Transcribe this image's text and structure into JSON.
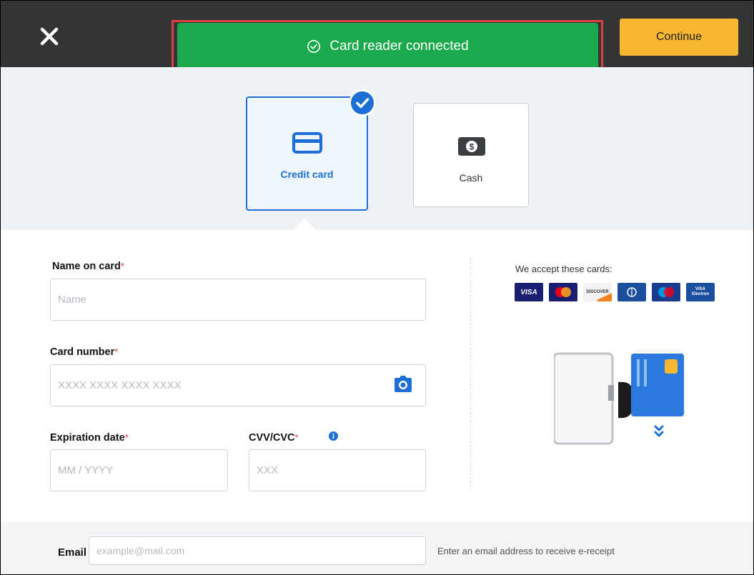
{
  "header": {
    "close_icon": "close-icon",
    "continue_label": "Continue",
    "toast_text": "Card reader connected",
    "toast_icon": "check-circle-icon",
    "toast_color": "#1aa94c",
    "accent_color": "#1d6fd6",
    "continue_color": "#f7b731"
  },
  "payment_methods": [
    {
      "label": "Credit card",
      "icon": "credit-card-icon",
      "selected": true
    },
    {
      "label": "Cash",
      "icon": "cash-icon",
      "selected": false
    }
  ],
  "form": {
    "name": {
      "label": "Name on card",
      "required_mark": "*",
      "placeholder": "Name",
      "value": ""
    },
    "card_number": {
      "label": "Card number",
      "required_mark": "*",
      "placeholder": "XXXX XXXX XXXX XXXX",
      "value": "",
      "scan_icon": "camera-icon"
    },
    "expiration": {
      "label": "Expiration date",
      "required_mark": "*",
      "placeholder": "MM / YYYY",
      "value": ""
    },
    "cvv": {
      "label": "CVV/CVC",
      "required_mark": "*",
      "placeholder": "XXX",
      "value": "",
      "info_icon": "info-icon"
    }
  },
  "accepted_cards": {
    "label": "We accept these cards:",
    "brands": [
      {
        "name": "VISA",
        "color": "#1a1f71"
      },
      {
        "name": "MasterCard",
        "color": "#1a1f71"
      },
      {
        "name": "DISCOVER",
        "color": "#f2f2f2"
      },
      {
        "name": "Diners Club",
        "color": "#1b4f9c"
      },
      {
        "name": "Maestro",
        "color": "#1a3b8f"
      },
      {
        "name": "VISA Electron",
        "color": "#1a4fa0"
      }
    ]
  },
  "email": {
    "label": "Email",
    "placeholder": "example@mail.com",
    "value": "",
    "hint": "Enter an email address to receive e-receipt"
  }
}
